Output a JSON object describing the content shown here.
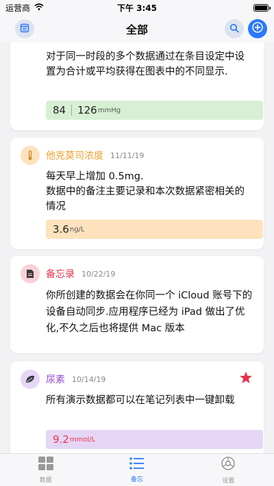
{
  "status_bar": {
    "carrier": "运营商",
    "time": "下午 3:45"
  },
  "nav": {
    "title": "全部"
  },
  "colors": {
    "accent": "#2979ff",
    "green": "#d7f0d3",
    "orange": "#fde2bd",
    "purple": "#e6d6f6",
    "red_icon": "#e8344b",
    "orange_icon": "#f0a030",
    "purple_icon": "#9a4fd0"
  },
  "cards": [
    {
      "note": "对于同一时段的多个数据通过在条目设定中设置为合计或平均获得在图表中的不同显示.",
      "value1": "84",
      "value2": "126",
      "unit": "mmHg"
    },
    {
      "title": "他克莫司浓度",
      "date": "11/11/19",
      "note_line1": "每天早上增加 0.5mg.",
      "note_line2": "数据中的备注主要记录和本次数据紧密相关的情况",
      "value": "3.6",
      "unit": "ng/L"
    },
    {
      "title": "备忘录",
      "date": "10/22/19",
      "note": "你所创建的数据会在你同一个 iCloud 账号下的设备自动同步.应用程序已经为 iPad 做出了优化,不久之后也将提供 Mac 版本"
    },
    {
      "title": "尿素",
      "date": "10/14/19",
      "note": "所有演示数据都可以在笔记列表中一键卸载",
      "value": "9.2",
      "unit": "mmol/L",
      "starred": true
    }
  ],
  "tabs": [
    {
      "label": "数据",
      "icon": "grid-icon"
    },
    {
      "label": "备忘",
      "icon": "list-icon",
      "active": true
    },
    {
      "label": "设置",
      "icon": "gear-icon"
    }
  ]
}
